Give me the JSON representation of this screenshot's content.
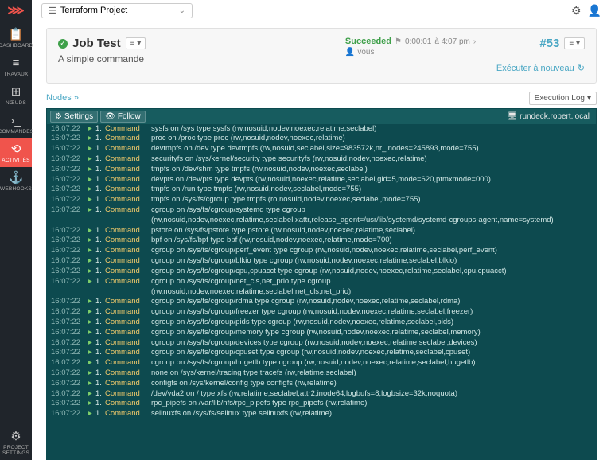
{
  "project": {
    "name": "Terraform Project"
  },
  "nav": [
    {
      "id": "dashboard",
      "label": "DASHBOARD",
      "icon": "📋"
    },
    {
      "id": "travaux",
      "label": "TRAVAUX",
      "icon": "≡"
    },
    {
      "id": "noeuds",
      "label": "NŒUDS",
      "icon": "⊞"
    },
    {
      "id": "commandes",
      "label": "COMMANDES",
      "icon": "›_"
    },
    {
      "id": "activites",
      "label": "ACTIVITÉS",
      "icon": "⟲",
      "active": true
    },
    {
      "id": "webhooks",
      "label": "WEBHOOKS",
      "icon": "⚓"
    }
  ],
  "nav_bottom": {
    "id": "project-settings",
    "label": "PROJECT SETTINGS",
    "icon": "⚙"
  },
  "job": {
    "title": "Job Test",
    "description": "A simple commande",
    "status": "Succeeded",
    "duration": "0:00:01",
    "time": "à 4:07 pm",
    "user_label": "vous",
    "exec_id": "#53",
    "run_again": "Exécuter à nouveau"
  },
  "subhead": {
    "nodes": "Nodes »",
    "exec_log": "Execution Log"
  },
  "log_controls": {
    "settings": "Settings",
    "follow": "Follow"
  },
  "node": "rundeck.robert.local",
  "log": [
    {
      "t": "16:07:22",
      "s": "1.",
      "c": "Command",
      "x": "sysfs on /sys type sysfs (rw,nosuid,nodev,noexec,relatime,seclabel)"
    },
    {
      "t": "16:07:22",
      "s": "1.",
      "c": "Command",
      "x": "proc on /proc type proc (rw,nosuid,nodev,noexec,relatime)"
    },
    {
      "t": "16:07:22",
      "s": "1.",
      "c": "Command",
      "x": "devtmpfs on /dev type devtmpfs (rw,nosuid,seclabel,size=983572k,nr_inodes=245893,mode=755)"
    },
    {
      "t": "16:07:22",
      "s": "1.",
      "c": "Command",
      "x": "securityfs on /sys/kernel/security type securityfs (rw,nosuid,nodev,noexec,relatime)"
    },
    {
      "t": "16:07:22",
      "s": "1.",
      "c": "Command",
      "x": "tmpfs on /dev/shm type tmpfs (rw,nosuid,nodev,noexec,seclabel)"
    },
    {
      "t": "16:07:22",
      "s": "1.",
      "c": "Command",
      "x": "devpts on /dev/pts type devpts (rw,nosuid,noexec,relatime,seclabel,gid=5,mode=620,ptmxmode=000)"
    },
    {
      "t": "16:07:22",
      "s": "1.",
      "c": "Command",
      "x": "tmpfs on /run type tmpfs (rw,nosuid,nodev,seclabel,mode=755)"
    },
    {
      "t": "16:07:22",
      "s": "1.",
      "c": "Command",
      "x": "tmpfs on /sys/fs/cgroup type tmpfs (ro,nosuid,nodev,noexec,seclabel,mode=755)"
    },
    {
      "t": "16:07:22",
      "s": "1.",
      "c": "Command",
      "x": "cgroup on /sys/fs/cgroup/systemd type cgroup"
    },
    {
      "cont": true,
      "x": "(rw,nosuid,nodev,noexec,relatime,seclabel,xattr,release_agent=/usr/lib/systemd/systemd-cgroups-agent,name=systemd)"
    },
    {
      "t": "16:07:22",
      "s": "1.",
      "c": "Command",
      "x": "pstore on /sys/fs/pstore type pstore (rw,nosuid,nodev,noexec,relatime,seclabel)"
    },
    {
      "t": "16:07:22",
      "s": "1.",
      "c": "Command",
      "x": "bpf on /sys/fs/bpf type bpf (rw,nosuid,nodev,noexec,relatime,mode=700)"
    },
    {
      "t": "16:07:22",
      "s": "1.",
      "c": "Command",
      "x": "cgroup on /sys/fs/cgroup/perf_event type cgroup (rw,nosuid,nodev,noexec,relatime,seclabel,perf_event)"
    },
    {
      "t": "16:07:22",
      "s": "1.",
      "c": "Command",
      "x": "cgroup on /sys/fs/cgroup/blkio type cgroup (rw,nosuid,nodev,noexec,relatime,seclabel,blkio)"
    },
    {
      "t": "16:07:22",
      "s": "1.",
      "c": "Command",
      "x": "cgroup on /sys/fs/cgroup/cpu,cpuacct type cgroup (rw,nosuid,nodev,noexec,relatime,seclabel,cpu,cpuacct)"
    },
    {
      "t": "16:07:22",
      "s": "1.",
      "c": "Command",
      "x": "cgroup on /sys/fs/cgroup/net_cls,net_prio type cgroup"
    },
    {
      "cont": true,
      "x": "(rw,nosuid,nodev,noexec,relatime,seclabel,net_cls,net_prio)"
    },
    {
      "t": "16:07:22",
      "s": "1.",
      "c": "Command",
      "x": "cgroup on /sys/fs/cgroup/rdma type cgroup (rw,nosuid,nodev,noexec,relatime,seclabel,rdma)"
    },
    {
      "t": "16:07:22",
      "s": "1.",
      "c": "Command",
      "x": "cgroup on /sys/fs/cgroup/freezer type cgroup (rw,nosuid,nodev,noexec,relatime,seclabel,freezer)"
    },
    {
      "t": "16:07:22",
      "s": "1.",
      "c": "Command",
      "x": "cgroup on /sys/fs/cgroup/pids type cgroup (rw,nosuid,nodev,noexec,relatime,seclabel,pids)"
    },
    {
      "t": "16:07:22",
      "s": "1.",
      "c": "Command",
      "x": "cgroup on /sys/fs/cgroup/memory type cgroup (rw,nosuid,nodev,noexec,relatime,seclabel,memory)"
    },
    {
      "t": "16:07:22",
      "s": "1.",
      "c": "Command",
      "x": "cgroup on /sys/fs/cgroup/devices type cgroup (rw,nosuid,nodev,noexec,relatime,seclabel,devices)"
    },
    {
      "t": "16:07:22",
      "s": "1.",
      "c": "Command",
      "x": "cgroup on /sys/fs/cgroup/cpuset type cgroup (rw,nosuid,nodev,noexec,relatime,seclabel,cpuset)"
    },
    {
      "t": "16:07:22",
      "s": "1.",
      "c": "Command",
      "x": "cgroup on /sys/fs/cgroup/hugetlb type cgroup (rw,nosuid,nodev,noexec,relatime,seclabel,hugetlb)"
    },
    {
      "t": "16:07:22",
      "s": "1.",
      "c": "Command",
      "x": "none on /sys/kernel/tracing type tracefs (rw,relatime,seclabel)"
    },
    {
      "t": "16:07:22",
      "s": "1.",
      "c": "Command",
      "x": "configfs on /sys/kernel/config type configfs (rw,relatime)"
    },
    {
      "t": "16:07:22",
      "s": "1.",
      "c": "Command",
      "x": "/dev/vda2 on / type xfs (rw,relatime,seclabel,attr2,inode64,logbufs=8,logbsize=32k,noquota)"
    },
    {
      "t": "16:07:22",
      "s": "1.",
      "c": "Command",
      "x": "rpc_pipefs on /var/lib/nfs/rpc_pipefs type rpc_pipefs (rw,relatime)"
    },
    {
      "t": "16:07:22",
      "s": "1.",
      "c": "Command",
      "x": "selinuxfs on /sys/fs/selinux type selinuxfs (rw,relatime)"
    }
  ]
}
